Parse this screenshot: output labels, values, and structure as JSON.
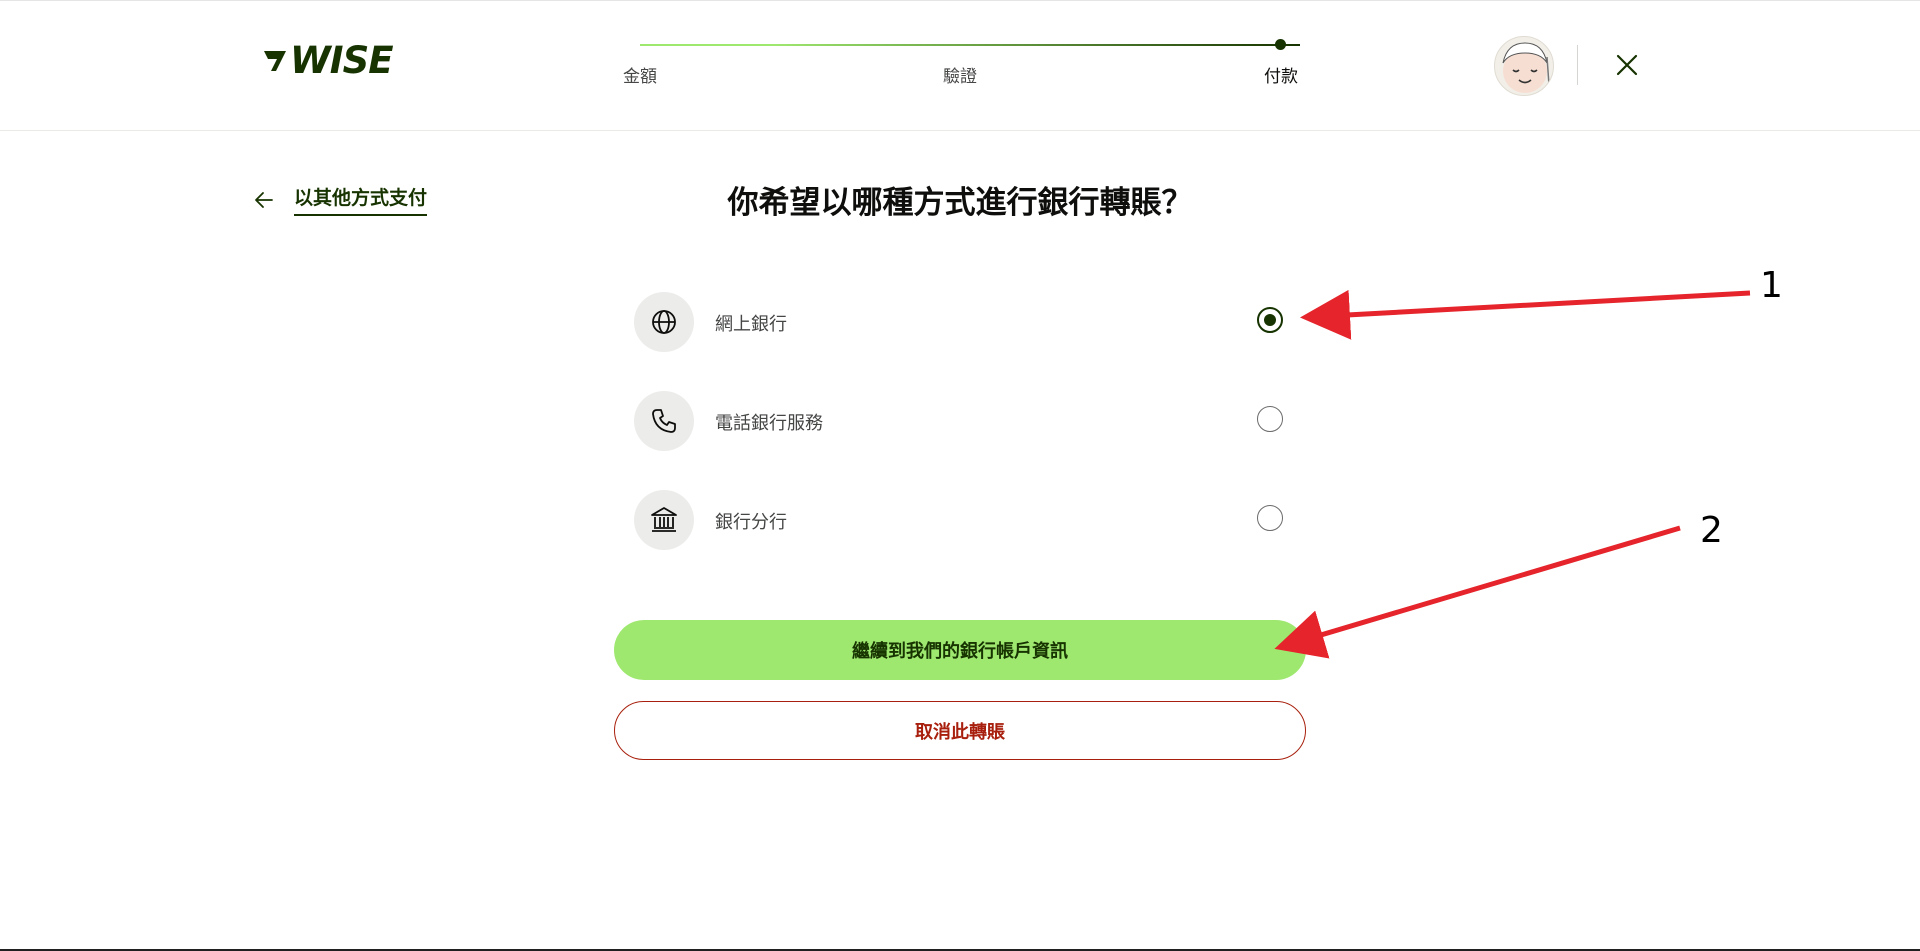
{
  "brand": {
    "logo_text": "WISE",
    "logo_color": "#163300"
  },
  "stepper": {
    "steps": [
      {
        "label": "金額"
      },
      {
        "label": "驗證"
      },
      {
        "label": "付款"
      }
    ],
    "active_step": "付款",
    "progress": 1.0
  },
  "header": {
    "avatar_icon": "user-avatar",
    "close_icon": "close-icon"
  },
  "back_link": {
    "label": "以其他方式支付",
    "icon": "arrow-left-icon"
  },
  "page_title": "你希望以哪種方式進行銀行轉賬？",
  "options": [
    {
      "label": "網上銀行",
      "icon": "globe-icon",
      "selected": true
    },
    {
      "label": "電話銀行服務",
      "icon": "phone-icon",
      "selected": false
    },
    {
      "label": "銀行分行",
      "icon": "bank-icon",
      "selected": false
    }
  ],
  "buttons": {
    "primary_label": "繼續到我們的銀行帳戶資訊",
    "secondary_label": "取消此轉賬"
  },
  "annotations": [
    {
      "label": "1"
    },
    {
      "label": "2"
    }
  ],
  "colors": {
    "accent_green": "#9fe870",
    "forest_green": "#163300",
    "danger_red": "#a8200d",
    "annotation_red": "#e5242b"
  }
}
